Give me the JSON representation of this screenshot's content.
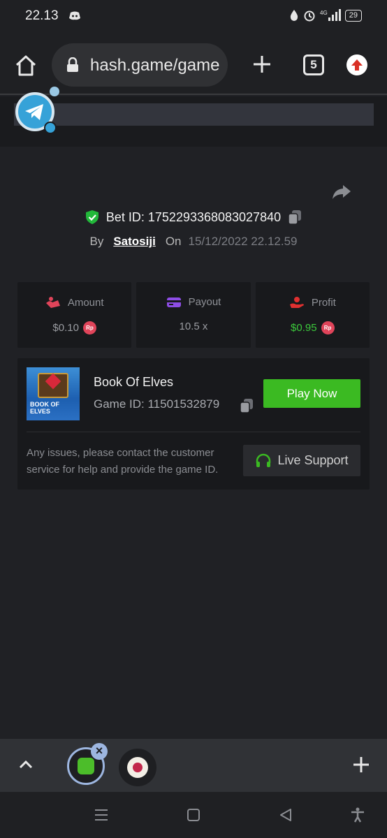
{
  "status_bar": {
    "time": "22.13",
    "network": "4G",
    "battery": "29"
  },
  "browser": {
    "url": "hash.game/game",
    "tab_count": "5"
  },
  "bet": {
    "bet_id_label": "Bet ID: 1752293368083027840",
    "by_label": "By",
    "user": "Satosiji",
    "on_label": "On",
    "date": "15/12/2022 22.12.59"
  },
  "stats": [
    {
      "label": "Amount",
      "value": "$0.10",
      "currency": "Rp",
      "icon": "amount-icon",
      "color": "#e0445a"
    },
    {
      "label": "Payout",
      "value": "10.5 x",
      "icon": "card-icon",
      "color": "#8e4de6"
    },
    {
      "label": "Profit",
      "value": "$0.95",
      "currency": "Rp",
      "icon": "hand-coin-icon",
      "color": "#e03030"
    }
  ],
  "game": {
    "name": "Book Of Elves",
    "thumb_text": "BOOK OF ELVES",
    "game_id_label": "Game ID: 11501532879",
    "play_label": "Play Now",
    "issue_text": "Any issues, please contact the customer service for help and provide the game ID.",
    "support_label": "Live Support"
  },
  "colors": {
    "accent_green": "#3bba22",
    "profit_green": "#3cc93c",
    "badge_red": "#e0445a"
  }
}
